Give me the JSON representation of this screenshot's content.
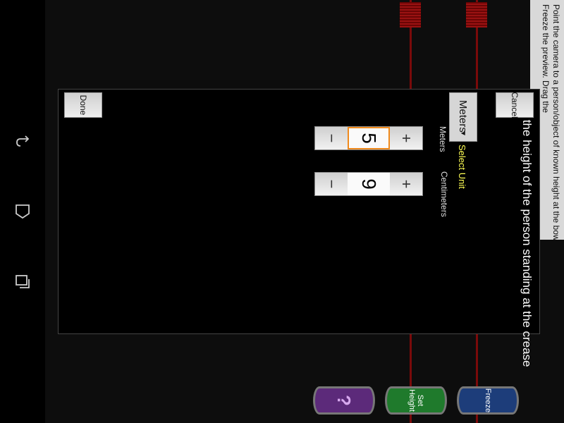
{
  "instruction": {
    "line1": "Point the camera to a person/object of known height at the bowling crease.",
    "line2": "Freeze the preview. Drag the"
  },
  "dialog": {
    "title": "Pick the height of the person standing at the crease",
    "unit_dropdown": "Meters",
    "select_unit_label": "Select Unit",
    "meters_label": "Meters",
    "centimeters_label": "Centimeters",
    "meters_value": "5",
    "centimeters_value": "9",
    "done_label": "Done",
    "cancel_label": "Cancel"
  },
  "buttons": {
    "freeze": "Freeze",
    "set_height": "Set Height",
    "help": "?"
  },
  "colors": {
    "marker": "#7a0a0a",
    "focus": "#f08a1c",
    "select_unit": "#ffff55"
  }
}
